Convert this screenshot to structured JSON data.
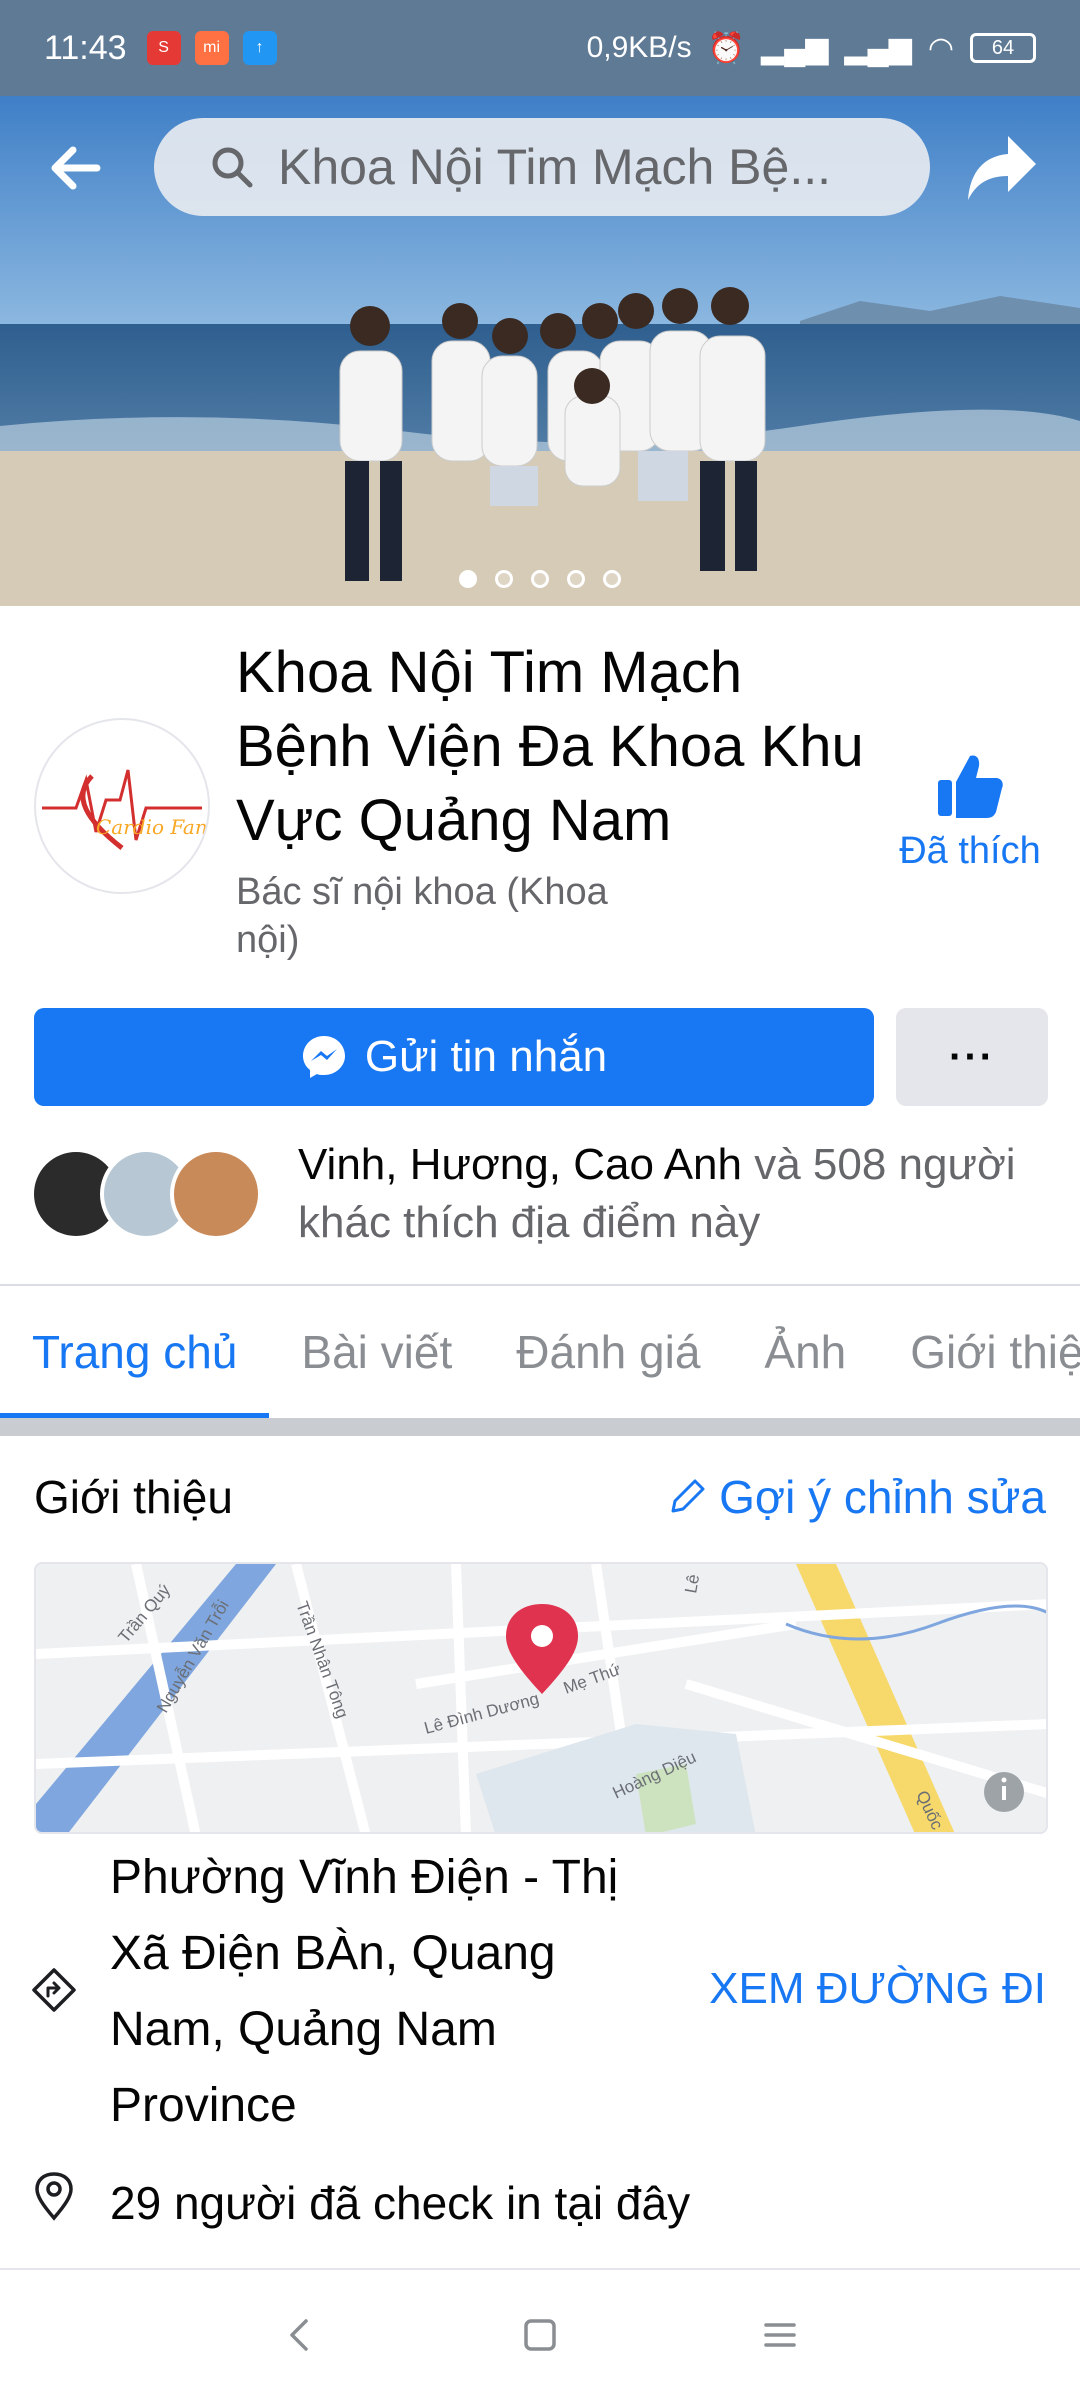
{
  "status_bar": {
    "time": "11:43",
    "network_speed": "0,9KB/s",
    "battery": "64"
  },
  "top_bar": {
    "search_text": "Khoa Nội Tim Mạch Bệ..."
  },
  "page": {
    "title": "Khoa Nội Tim Mạch Bệnh Viện Đa Khoa Khu Vực Quảng Nam",
    "category": "Bác sĩ nội khoa (Khoa nội)",
    "logo_text": "Cardio Family",
    "liked_label": "Đã thích"
  },
  "actions": {
    "message_label": "Gửi tin nhắn",
    "more_label": "···"
  },
  "likes": {
    "names": "Vinh, Hương, Cao Anh",
    "rest": " và 508 người khác thích địa điểm này"
  },
  "tabs": [
    {
      "label": "Trang chủ",
      "active": true
    },
    {
      "label": "Bài viết",
      "active": false
    },
    {
      "label": "Đánh giá",
      "active": false
    },
    {
      "label": "Ảnh",
      "active": false
    },
    {
      "label": "Giới thiệu",
      "active": false
    }
  ],
  "intro": {
    "title": "Giới thiệu",
    "suggest_edit": "Gợi ý chỉnh sửa",
    "map_labels": [
      "Trần Quý",
      "Nguyễn Văn Trỗi",
      "Trần Nhân Tông",
      "Lê Đình Dương",
      "Mẹ Thứ",
      "Hoàng Diệu",
      "Lê",
      "Quốc"
    ],
    "address": "Phường Vĩnh Điện - Thị Xã Điện BÀn, Quang Nam, Quảng Nam Province",
    "directions_label": "XEM ĐƯỜNG ĐI",
    "checkin_text": "29 người đã check in tại đây"
  },
  "colors": {
    "primary": "#1877f2",
    "status_bar": "#5f7a95"
  }
}
